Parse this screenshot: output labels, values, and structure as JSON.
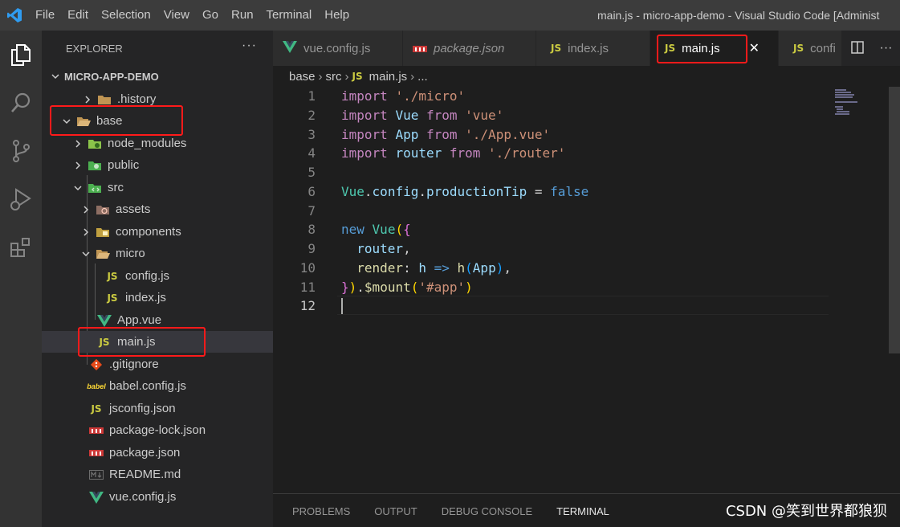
{
  "titlebar": {
    "menus": [
      "File",
      "Edit",
      "Selection",
      "View",
      "Go",
      "Run",
      "Terminal",
      "Help"
    ],
    "window_title": "main.js - micro-app-demo - Visual Studio Code [Administ"
  },
  "activity_bar": [
    "explorer-icon",
    "search-icon",
    "source-control-icon",
    "run-debug-icon",
    "extensions-icon"
  ],
  "sidebar": {
    "header": "EXPLORER",
    "more": "···",
    "project": "MICRO-APP-DEMO",
    "items": [
      {
        "label": ".history",
        "type": "folder",
        "expanded": false
      },
      {
        "label": "base",
        "type": "folder",
        "expanded": true
      },
      {
        "label": "node_modules",
        "type": "folder",
        "expanded": false
      },
      {
        "label": "public",
        "type": "folder",
        "expanded": false
      },
      {
        "label": "src",
        "type": "folder",
        "expanded": true
      },
      {
        "label": "assets",
        "type": "folder",
        "expanded": false
      },
      {
        "label": "components",
        "type": "folder",
        "expanded": false
      },
      {
        "label": "micro",
        "type": "folder",
        "expanded": true
      },
      {
        "label": "config.js",
        "type": "js"
      },
      {
        "label": "index.js",
        "type": "js"
      },
      {
        "label": "App.vue",
        "type": "vue"
      },
      {
        "label": "main.js",
        "type": "js",
        "selected": true
      },
      {
        "label": ".gitignore",
        "type": "git"
      },
      {
        "label": "babel.config.js",
        "type": "babel"
      },
      {
        "label": "jsconfig.json",
        "type": "js"
      },
      {
        "label": "package-lock.json",
        "type": "npm"
      },
      {
        "label": "package.json",
        "type": "npm"
      },
      {
        "label": "README.md",
        "type": "md"
      },
      {
        "label": "vue.config.js",
        "type": "vue"
      }
    ],
    "js_badge": "JS"
  },
  "tabs": [
    {
      "label": "vue.config.js",
      "icon": "vue"
    },
    {
      "label": "package.json",
      "icon": "npm"
    },
    {
      "label": "index.js",
      "icon": "js"
    },
    {
      "label": "main.js",
      "icon": "js",
      "active": true
    },
    {
      "label": "confi",
      "icon": "js"
    }
  ],
  "tab_close": "✕",
  "breadcrumb": [
    "base",
    "src",
    "main.js",
    "..."
  ],
  "editor": {
    "line_numbers": [
      "1",
      "2",
      "3",
      "4",
      "5",
      "6",
      "7",
      "8",
      "9",
      "10",
      "11",
      "12"
    ],
    "current_line": 12
  },
  "panel": {
    "tabs": [
      "PROBLEMS",
      "OUTPUT",
      "DEBUG CONSOLE",
      "TERMINAL"
    ],
    "active": "TERMINAL"
  },
  "watermark": "CSDN @笑到世界都狼狈",
  "colors": {
    "accent_highlight": "#ff1a1a",
    "js_yellow": "#cbcb41",
    "vue_green": "#41b883"
  }
}
